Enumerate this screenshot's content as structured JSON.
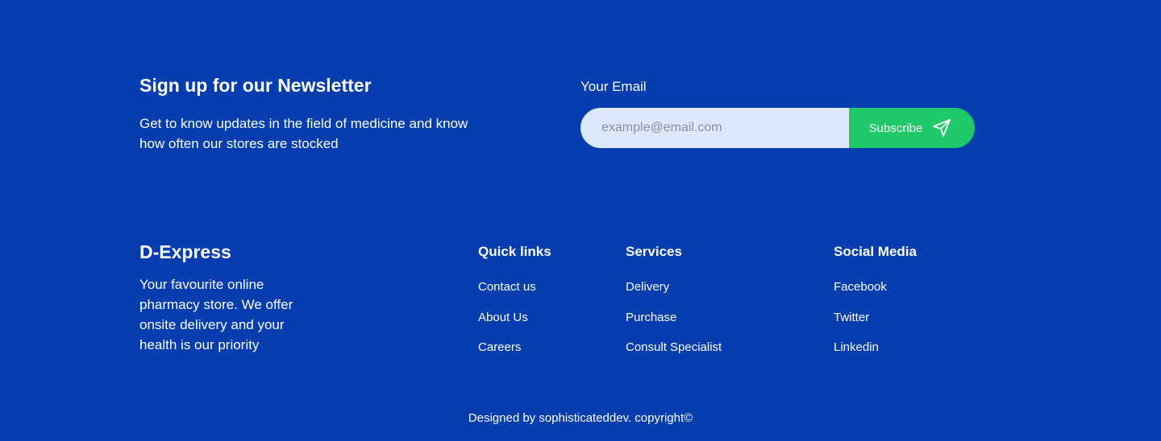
{
  "newsletter": {
    "title": "Sign up for our Newsletter",
    "description": "Get to know updates in the field of medicine and know how often our stores are stocked",
    "email_label": "Your Email",
    "email_placeholder": "example@email.com",
    "email_value": "",
    "subscribe_label": "Subscribe",
    "subscribe_icon": "send-icon"
  },
  "brand": {
    "name": "D-Express",
    "description": "Your favourite online pharmacy store. We offer onsite delivery and your health is our priority"
  },
  "columns": {
    "quick_links": {
      "heading": "Quick links",
      "items": [
        "Contact us",
        "About Us",
        "Careers"
      ]
    },
    "services": {
      "heading": "Services",
      "items": [
        "Delivery",
        "Purchase",
        "Consult Specialist"
      ]
    },
    "social": {
      "heading": "Social Media",
      "items": [
        "Facebook",
        "Twitter",
        "Linkedin"
      ]
    }
  },
  "footer": {
    "copyright": "Designed by sophisticateddev. copyright©"
  },
  "colors": {
    "background": "#033DAE",
    "input_background": "#DDE8FD",
    "accent_green": "#1EC96A",
    "text": "#FFFFFF"
  }
}
